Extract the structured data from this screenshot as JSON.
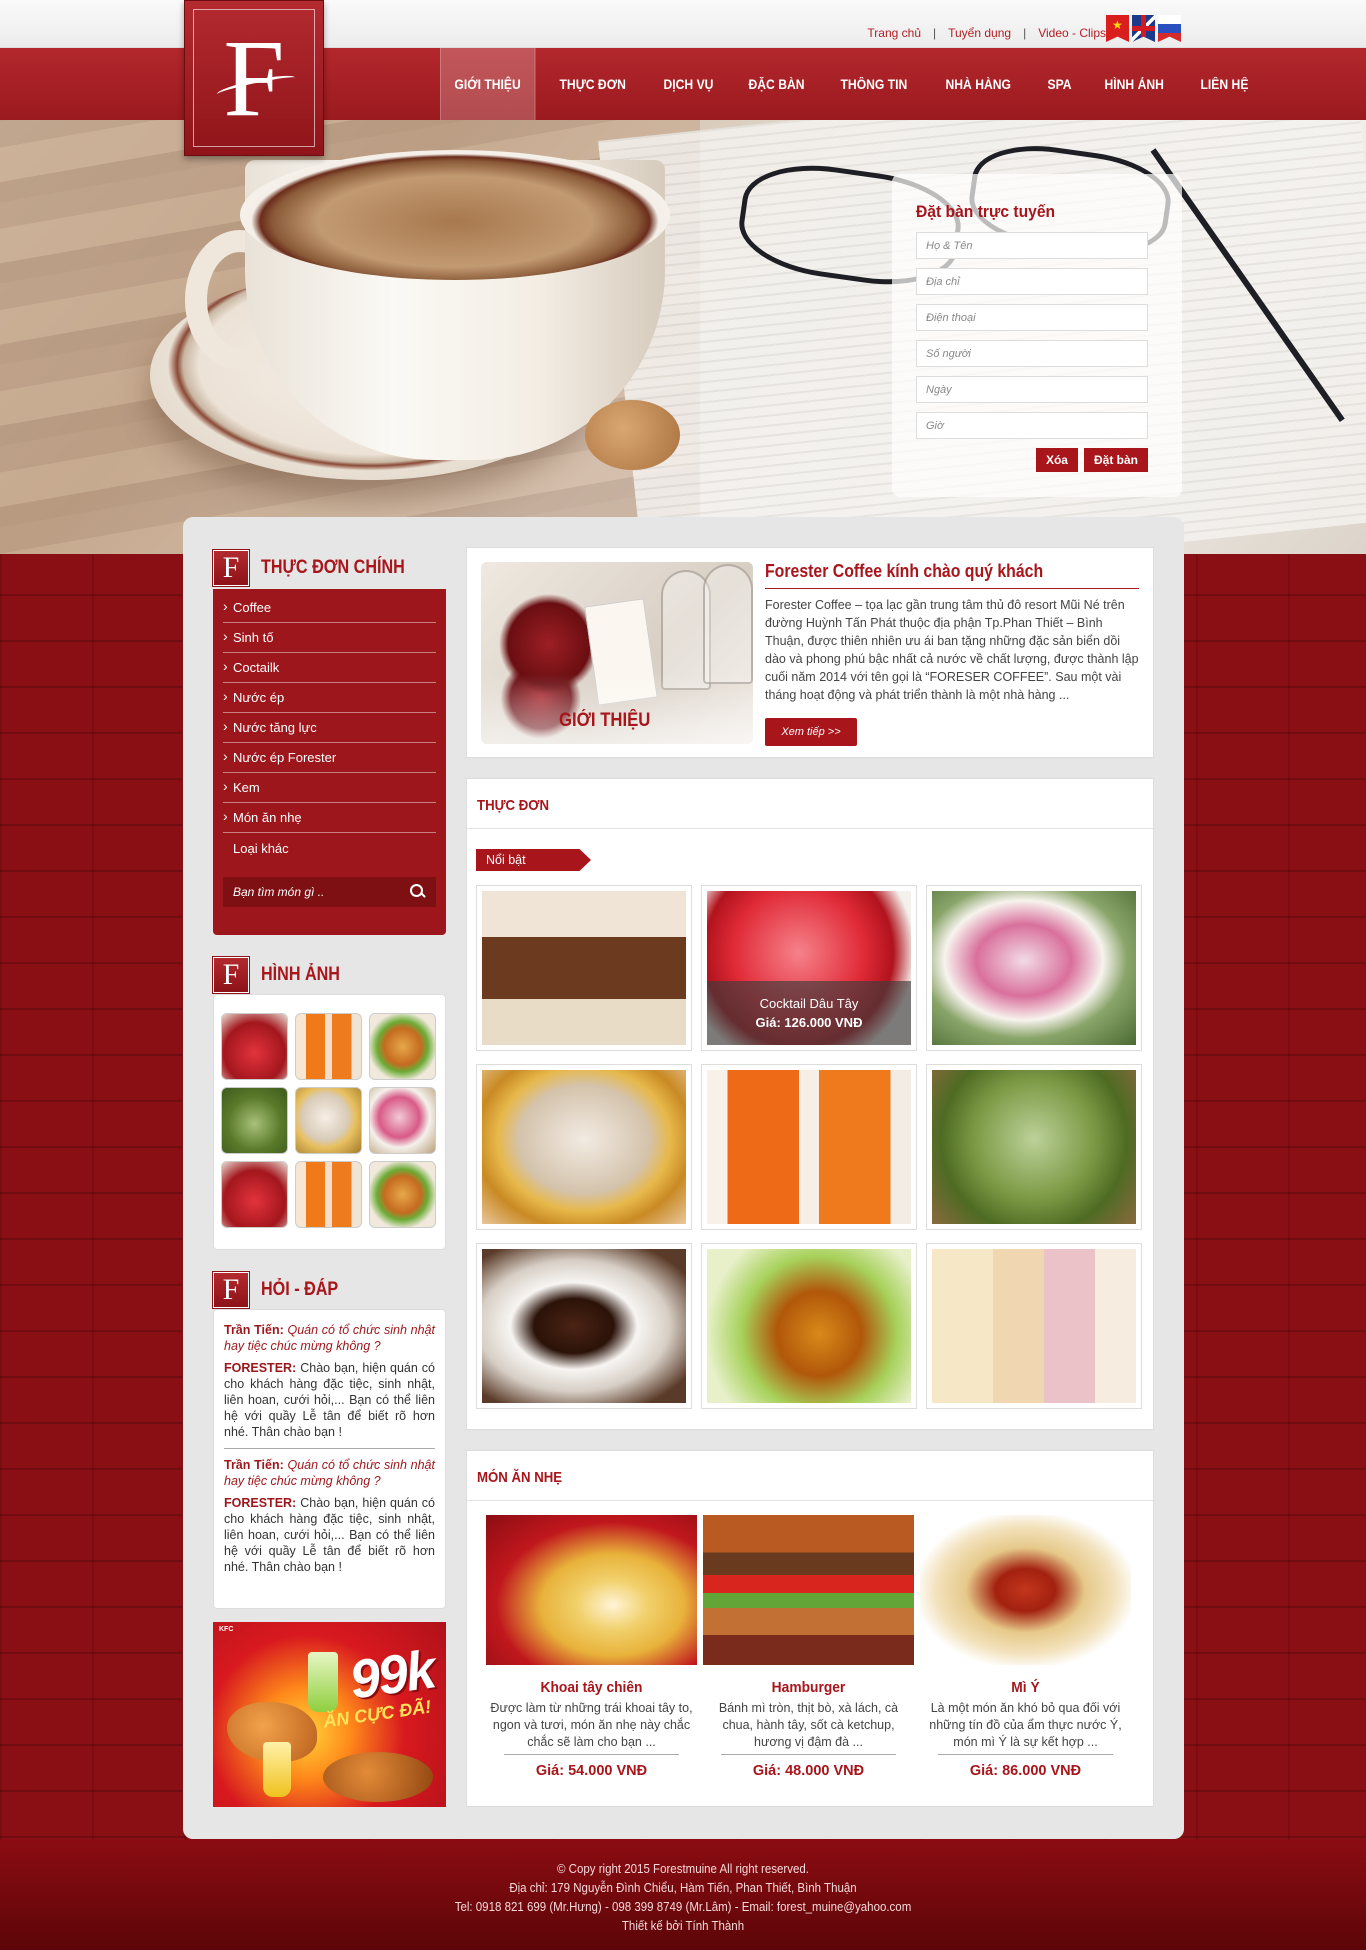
{
  "topbar": {
    "links": [
      "Trang chủ",
      "Tuyển dụng",
      "Video - Clips"
    ],
    "languages": [
      "vietnamese-flag-icon",
      "english-flag-icon",
      "russian-flag-icon"
    ]
  },
  "logo": {
    "letter": "F"
  },
  "nav": {
    "items": [
      "GIỚI THIỆU",
      "THỰC ĐƠN",
      "DỊCH VỤ",
      "ĐẶC BÀN",
      "THÔNG TIN",
      "NHÀ HÀNG",
      "SPA",
      "HÌNH ẢNH",
      "LIÊN HỆ"
    ],
    "active": "GIỚI THIỆU"
  },
  "booking": {
    "title": "Đặt bàn trực tuyến",
    "fields": [
      "Họ & Tên",
      "Địa chỉ",
      "Điện thoại",
      "Số người",
      "Ngày",
      "Giờ"
    ],
    "clear_label": "Xóa",
    "submit_label": "Đặt bàn"
  },
  "sidebar": {
    "menu_title": "THỰC ĐƠN CHÍNH",
    "menu_items": [
      "Coffee",
      "Sinh tố",
      "Coctailk",
      "Nước ép",
      "Nước tăng lực",
      "Nước ép Forester",
      "Kem",
      "Món ăn nhẹ",
      "Loại khác"
    ],
    "search_placeholder": "Bạn tìm món gì ..",
    "gallery_title": "HÌNH ẢNH",
    "qa_title": "HỎI - ĐÁP",
    "qa": [
      {
        "asker": "Trần Tiến:",
        "question": "Quán có tổ chức sinh nhật hay tiệc chúc mừng không ?",
        "answerer": "FORESTER:",
        "answer": "Chào bạn, hiện quán có cho khách hàng đặc tiệc, sinh nhật, liên hoan, cưới hỏi,... Bạn có thể liên hệ với quầy Lễ tân để biết rõ hơn nhé. Thân chào bạn !"
      },
      {
        "asker": "Trần Tiến:",
        "question": "Quán có tổ chức sinh nhật hay tiệc chúc mừng không ?",
        "answerer": "FORESTER:",
        "answer": "Chào bạn, hiện quán có cho khách hàng đặc tiệc, sinh nhật, liên hoan, cưới hỏi,... Bạn có thể liên hệ với quầy Lễ tân để biết rõ hơn nhé. Thân chào bạn !"
      }
    ],
    "ad": {
      "big": "99k",
      "small": "ĂN CỰC ĐÃ!",
      "brand": "KFC"
    }
  },
  "intro": {
    "image_caption": "GIỚI THIỆU",
    "title": "Forester Coffee kính chào quý khách",
    "text": "Forester Coffee – tọa lạc gần trung tâm thủ đô resort Mũi Né trên đường Huỳnh Tấn Phát thuộc địa phận Tp.Phan Thiết – Bình Thuận, được thiên nhiên ưu ái ban tặng những đặc sản biển dồi dào và phong phú bậc nhất cả nước về chất lượng, được thành lập cuối năm 2014 với tên gọi là “FORESER COFFEE”. Sau một vài tháng hoạt động và phát triển thành là một nhà hàng ...",
    "more_label": "Xem tiếp >>"
  },
  "menu_section": {
    "title": "THỰC ĐƠN",
    "tag": "Nổi bật",
    "featured": {
      "name": "Cocktail Dâu Tây",
      "price": "Giá: 126.000 VNĐ"
    }
  },
  "snack_section": {
    "title": "MÓN ĂN NHẸ",
    "items": [
      {
        "name": "Khoai tây chiên",
        "desc": "Được làm từ những trái khoai tây to, ngon và tươi, món ăn nhẹ này chắc chắc sẽ làm cho bạn ...",
        "price": "Giá: 54.000 VNĐ"
      },
      {
        "name": "Hamburger",
        "desc": "Bánh mì tròn, thịt bò, xà lách, cà chua, hành tây, sốt cà ketchup, hương vị đậm đà ...",
        "price": "Giá: 48.000 VNĐ"
      },
      {
        "name": "Mì Ý",
        "desc": "Là một món ăn khó bỏ qua đối với những tín đồ của ẩm thực nước Ý, món mì Ý là sự kết hợp ...",
        "price": "Giá: 86.000 VNĐ"
      }
    ]
  },
  "footer": {
    "lines": [
      "© Copy right 2015 Forestmuine All right reserved.",
      "Địa chỉ: 179 Nguyễn Đình Chiểu, Hàm Tiến, Phan Thiết, Bình Thuận",
      "Tel: 0918 821 699 (Mr.Hưng) - 098 399 8749 (Mr.Lâm)   -   Email: forest_muine@yahoo.com",
      "Thiết kế bởi Tính Thành"
    ]
  }
}
